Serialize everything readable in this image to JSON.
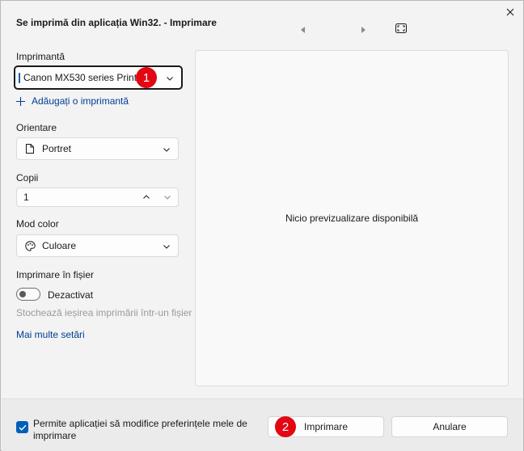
{
  "window": {
    "title": "Se imprimă din aplicația Win32. - Imprimare"
  },
  "printer": {
    "label": "Imprimantă",
    "selected": "Canon MX530 series Printer",
    "add_label": "Adăugați o imprimantă"
  },
  "orientation": {
    "label": "Orientare",
    "selected": "Portret"
  },
  "copies": {
    "label": "Copii",
    "value": "1"
  },
  "color_mode": {
    "label": "Mod color",
    "selected": "Culoare"
  },
  "print_to_file": {
    "label": "Imprimare în fișier",
    "state": "Dezactivat",
    "description": "Stochează ieșirea imprimării într-un fișier"
  },
  "more_settings": "Mai multe setări",
  "preview": {
    "message": "Nicio previzualizare disponibilă"
  },
  "footer": {
    "checkbox_label": "Permite aplicației să modifice preferințele mele de imprimare",
    "print_button": "Imprimare",
    "cancel_button": "Anulare"
  },
  "annotations": [
    "1",
    "2"
  ],
  "colors": {
    "accent": "#005fb8",
    "link": "#003e92",
    "badge": "#e30613"
  }
}
